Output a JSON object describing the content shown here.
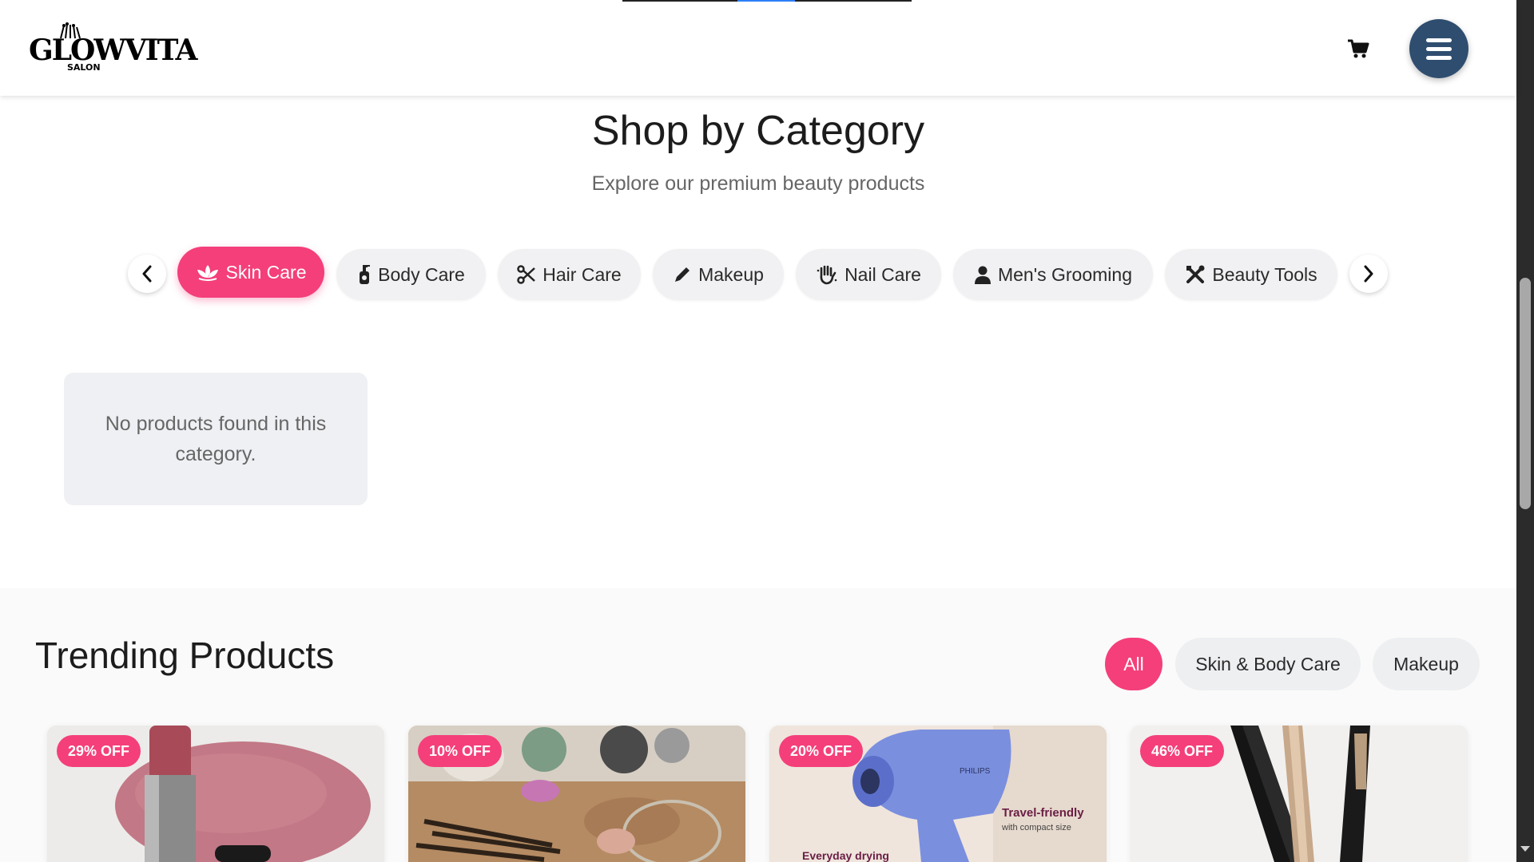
{
  "header": {
    "logo_text": "GLOWVITA",
    "logo_subtext": "SALON",
    "cart_icon": "cart-icon",
    "menu_icon": "hamburger-menu-icon"
  },
  "category_section": {
    "title": "Shop by Category",
    "subtitle": "Explore our premium beauty products",
    "prev_icon": "chevron-left-icon",
    "next_icon": "chevron-right-icon",
    "categories": [
      {
        "label": "Skin Care",
        "icon": "lotus-icon",
        "active": true
      },
      {
        "label": "Body Care",
        "icon": "pump-bottle-icon",
        "active": false
      },
      {
        "label": "Hair Care",
        "icon": "scissors-icon",
        "active": false
      },
      {
        "label": "Makeup",
        "icon": "pencil-icon",
        "active": false
      },
      {
        "label": "Nail Care",
        "icon": "hand-icon",
        "active": false
      },
      {
        "label": "Men's Grooming",
        "icon": "user-icon",
        "active": false
      },
      {
        "label": "Beauty Tools",
        "icon": "tools-icon",
        "active": false
      }
    ],
    "empty_message": "No products found in this category."
  },
  "trending_section": {
    "title": "Trending Products",
    "filters": [
      {
        "label": "All",
        "active": true
      },
      {
        "label": "Skin & Body Care",
        "active": false
      },
      {
        "label": "Makeup",
        "active": false
      }
    ],
    "products": [
      {
        "discount": "29% OFF",
        "image": "lipstick"
      },
      {
        "discount": "10% OFF",
        "image": "makeup-table"
      },
      {
        "discount": "20% OFF",
        "image": "hair-dryer",
        "image_text": [
          "PHILIPS",
          "Travel-friendly",
          "with compact size",
          "Everyday drying"
        ]
      },
      {
        "discount": "46% OFF",
        "image": "hair-styling-tools"
      }
    ]
  },
  "colors": {
    "accent": "#f43f7a",
    "menu_button": "#2f4d6f",
    "pill_bg": "#f1f1f3"
  }
}
